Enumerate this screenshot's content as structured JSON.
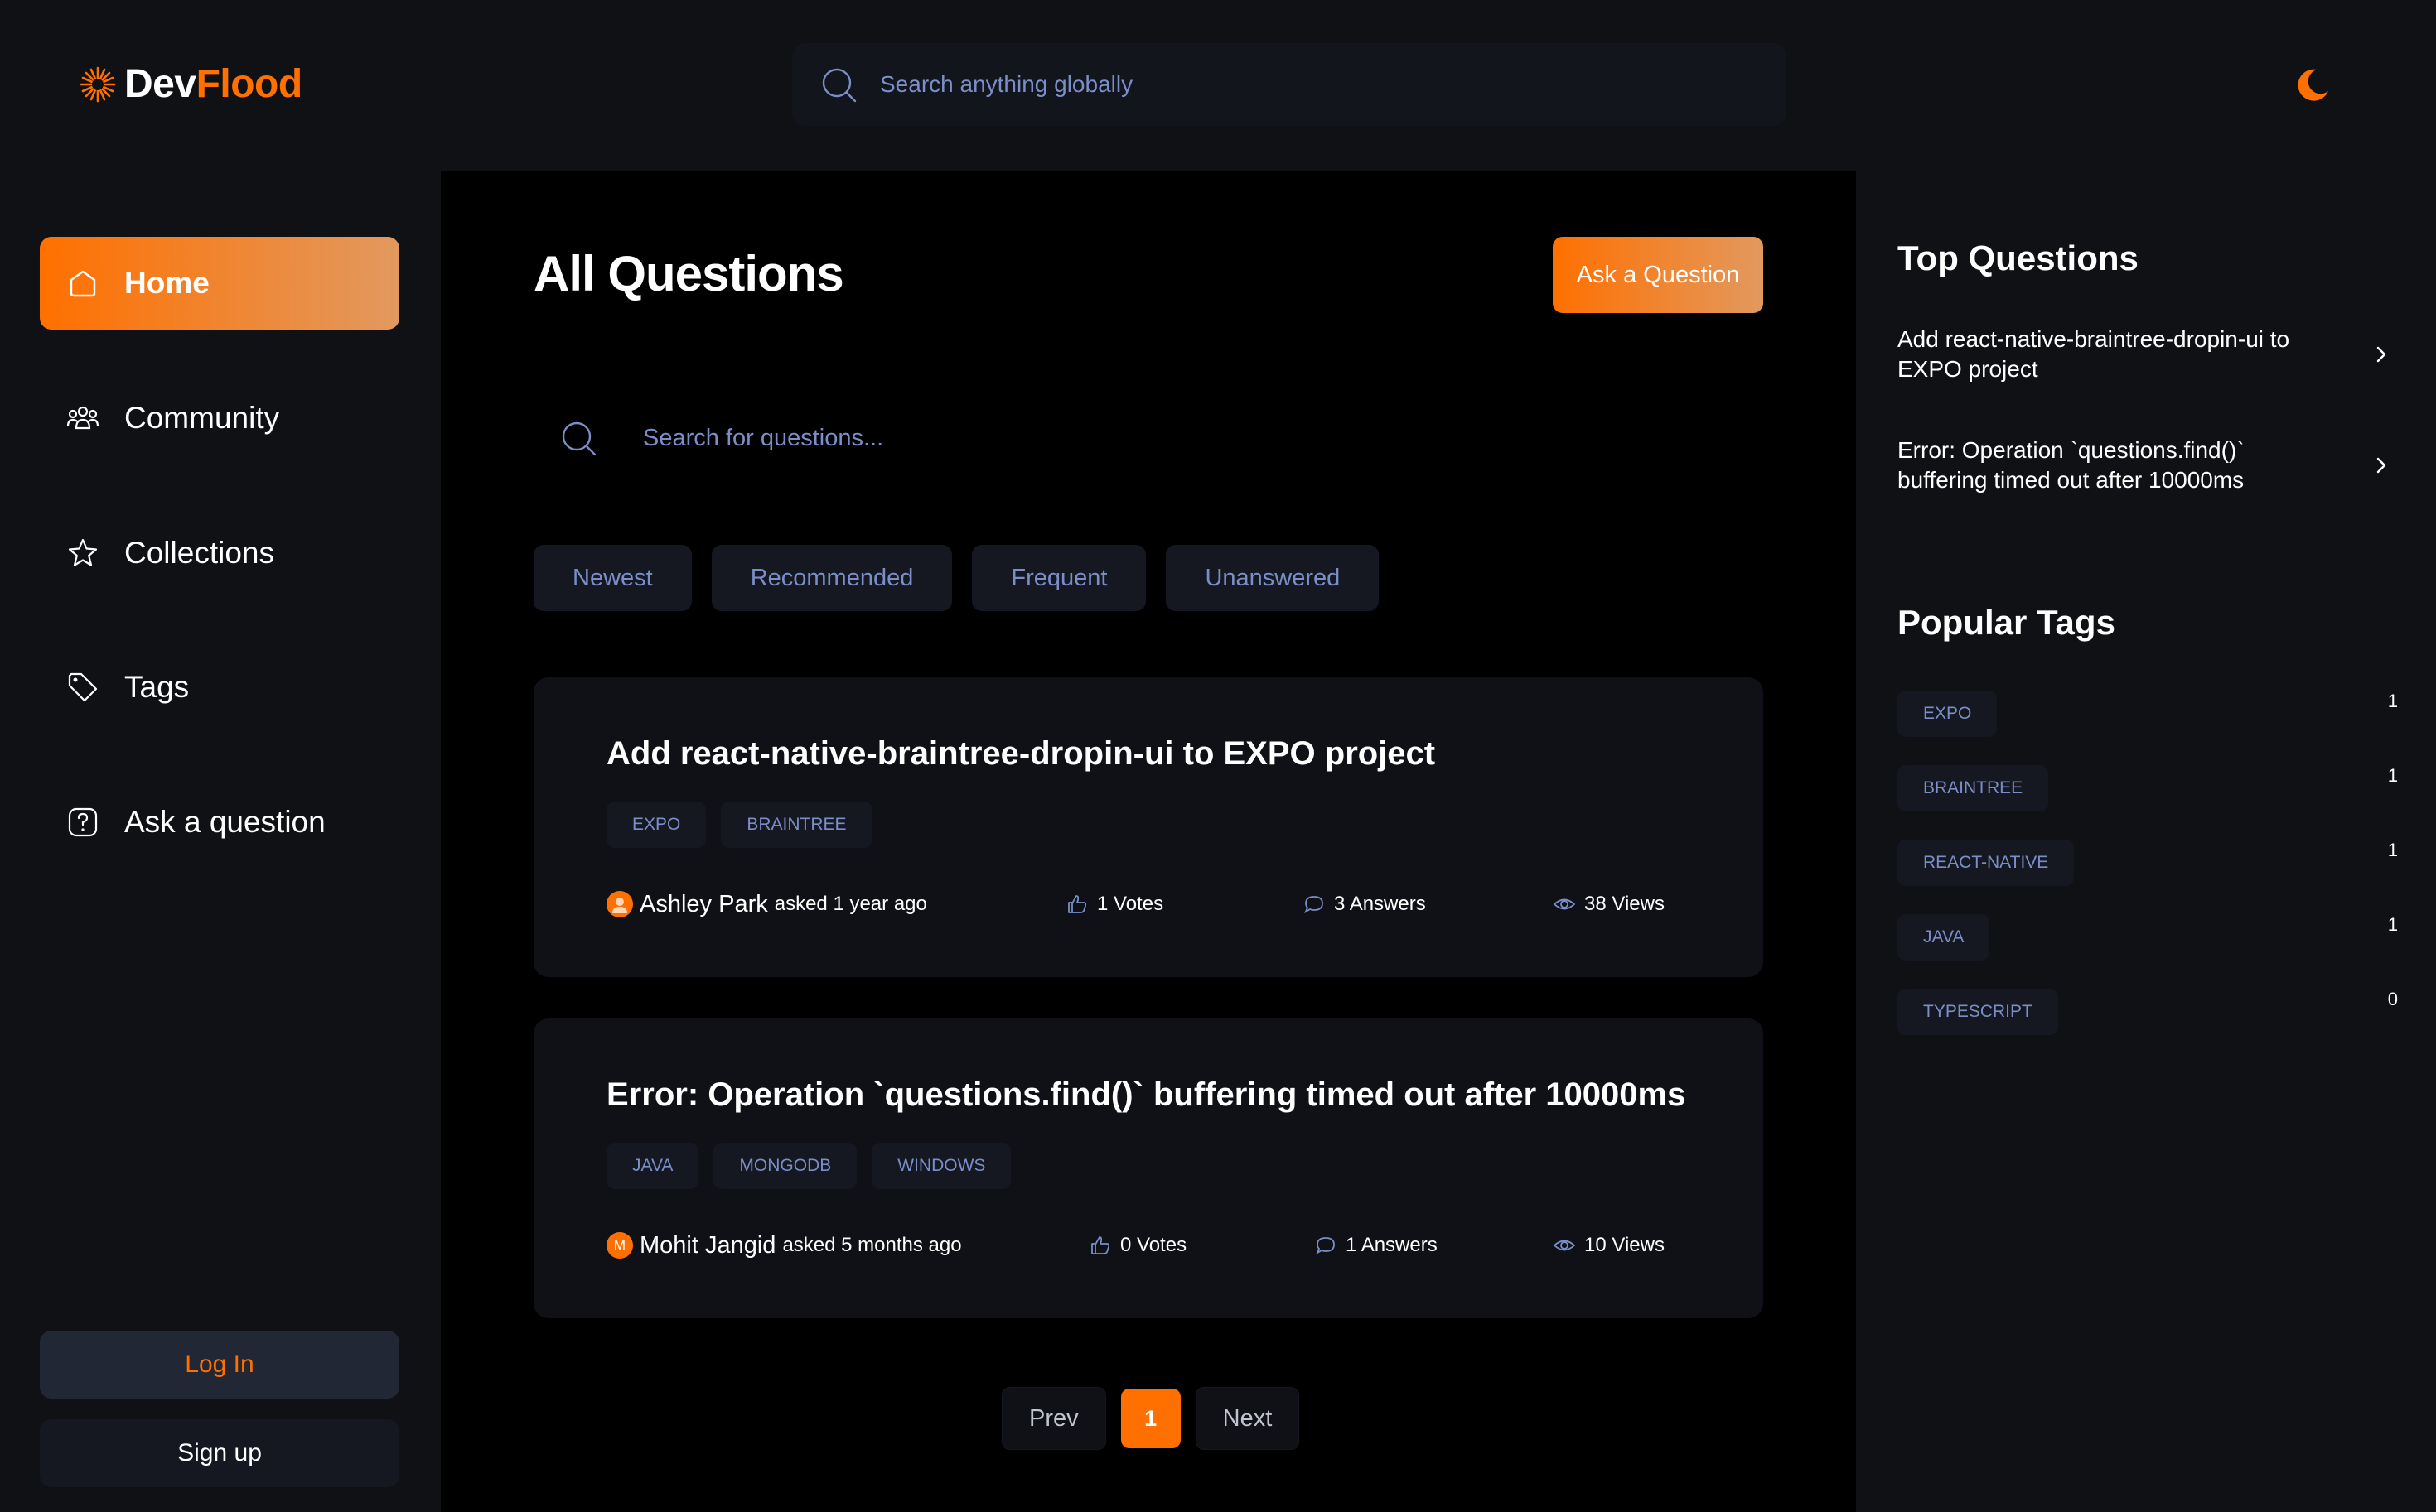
{
  "colors": {
    "accent": "#ff7000",
    "accent_end": "#e2995f",
    "muted_text": "#7b8ec8",
    "card_bg": "#0f1117",
    "chip_bg": "#151821"
  },
  "header": {
    "logo": {
      "dev": "Dev",
      "flood": "Flood",
      "icon": "sunburst-logo-icon"
    },
    "search_placeholder": "Search anything globally",
    "theme_icon": "moon-icon"
  },
  "sidebar": {
    "items": [
      {
        "label": "Home",
        "icon": "home-icon",
        "active": true
      },
      {
        "label": "Community",
        "icon": "users-icon"
      },
      {
        "label": "Collections",
        "icon": "star-icon"
      },
      {
        "label": "Tags",
        "icon": "tag-icon"
      },
      {
        "label": "Ask a question",
        "icon": "question-icon"
      }
    ],
    "login_label": "Log In",
    "signup_label": "Sign up"
  },
  "main": {
    "title": "All Questions",
    "ask_button": "Ask a Question",
    "search_placeholder": "Search for questions...",
    "filters": [
      "Newest",
      "Recommended",
      "Frequent",
      "Unanswered"
    ],
    "questions": [
      {
        "title": "Add react-native-braintree-dropin-ui to EXPO project",
        "tags": [
          "EXPO",
          "BRAINTREE"
        ],
        "author": "Ashley Park",
        "asked": "asked 1 year ago",
        "votes": "1 Votes",
        "answers": "3 Answers",
        "views": "38 Views"
      },
      {
        "title": "Error: Operation `questions.find()` buffering timed out after 10000ms",
        "tags": [
          "JAVA",
          "MONGODB",
          "WINDOWS"
        ],
        "author": "Mohit Jangid",
        "author_initial": "M",
        "asked": "asked 5 months ago",
        "votes": "0 Votes",
        "answers": "1 Answers",
        "views": "10 Views"
      }
    ],
    "pagination": {
      "prev": "Prev",
      "current": "1",
      "next": "Next"
    }
  },
  "rightbar": {
    "top_questions_heading": "Top Questions",
    "top_questions": [
      "Add react-native-braintree-dropin-ui to EXPO project",
      "Error: Operation `questions.find()` buffering timed out after 10000ms"
    ],
    "popular_tags_heading": "Popular Tags",
    "popular_tags": [
      {
        "name": "EXPO",
        "count": "1"
      },
      {
        "name": "BRAINTREE",
        "count": "1"
      },
      {
        "name": "REACT-NATIVE",
        "count": "1"
      },
      {
        "name": "JAVA",
        "count": "1"
      },
      {
        "name": "TYPESCRIPT",
        "count": "0"
      }
    ]
  }
}
